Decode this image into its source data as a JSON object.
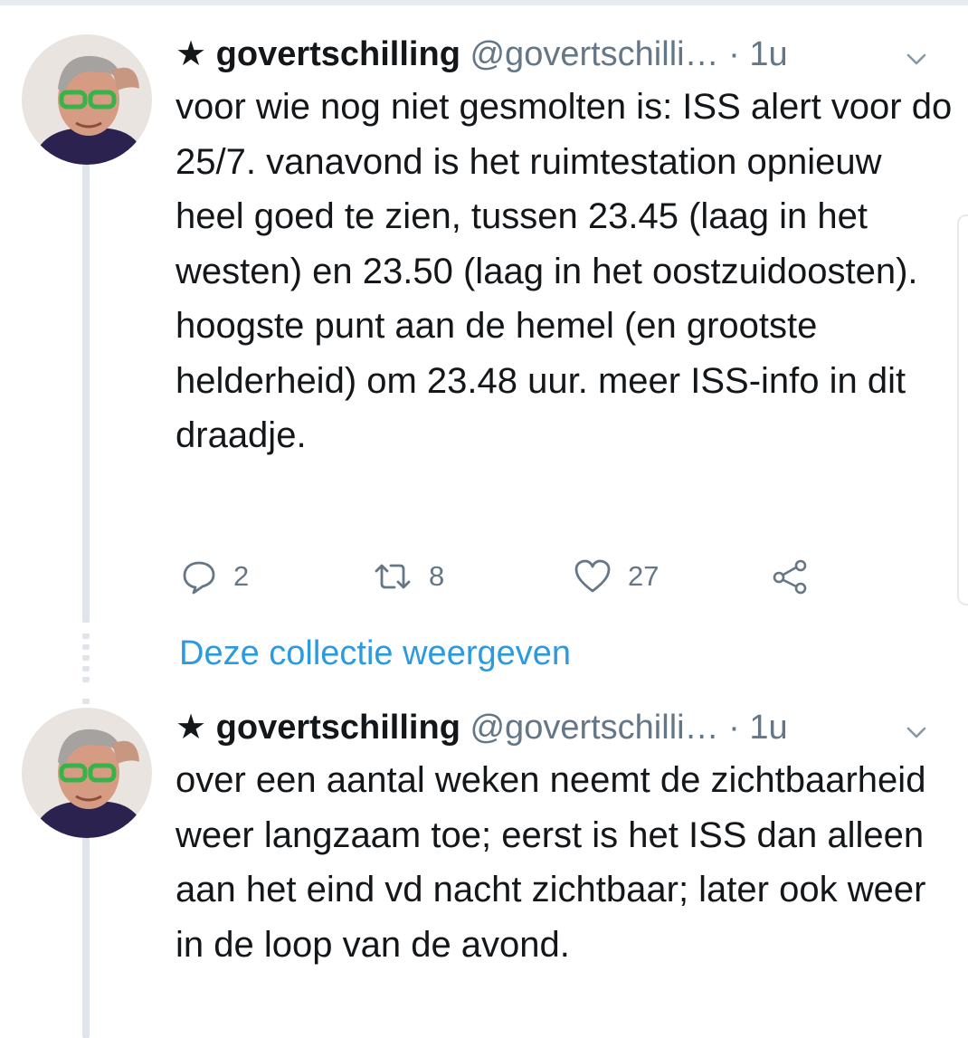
{
  "tweets": [
    {
      "star": "★",
      "username": "govertschilling",
      "handle": "@govertschilli…",
      "time": "· 1u",
      "text": "voor wie nog niet gesmolten is: ISS alert voor do 25/7. vanavond is het ruimtestation opnieuw heel goed te zien, tussen 23.45 (laag in het westen) en 23.50 (laag in het oostzuidoosten). hoogste punt aan de hemel (en grootste helderheid) om 23.48 uur. meer ISS-info in dit draadje.",
      "actions": {
        "reply_count": "2",
        "retweet_count": "8",
        "like_count": "27"
      }
    },
    {
      "star": "★",
      "username": "govertschilling",
      "handle": "@govertschilli…",
      "time": "· 1u",
      "text": "over een aantal weken neemt de zichtbaarheid weer langzaam toe; eerst is het ISS dan alleen aan het eind vd nacht zichtbaar; later ook weer in de loop van de avond."
    }
  ],
  "collection_link": "Deze collectie weergeven",
  "icons": [
    "reply-icon",
    "retweet-icon",
    "like-icon",
    "share-icon",
    "chevron-down-icon"
  ],
  "colors": {
    "text": "#14171a",
    "secondary": "#657786",
    "link": "#2b9ae0",
    "thread_line": "#dfe5ea"
  }
}
